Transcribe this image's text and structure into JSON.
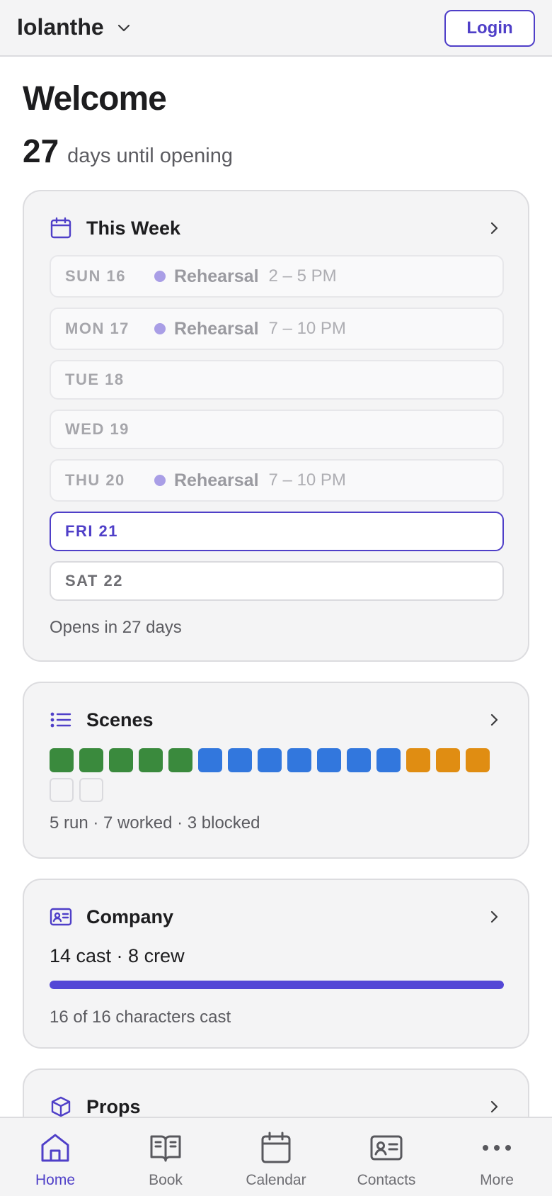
{
  "header": {
    "show_name": "Iolanthe",
    "login_label": "Login"
  },
  "welcome": {
    "title": "Welcome",
    "days_number": "27",
    "days_label": "days until opening"
  },
  "this_week": {
    "title": "This Week",
    "days": [
      {
        "day": "SUN 16",
        "event": "Rehearsal",
        "time": "2 – 5 PM",
        "state": "past"
      },
      {
        "day": "MON 17",
        "event": "Rehearsal",
        "time": "7 – 10 PM",
        "state": "past"
      },
      {
        "day": "TUE 18",
        "event": "",
        "time": "",
        "state": "past"
      },
      {
        "day": "WED 19",
        "event": "",
        "time": "",
        "state": "past"
      },
      {
        "day": "THU 20",
        "event": "Rehearsal",
        "time": "7 – 10 PM",
        "state": "past"
      },
      {
        "day": "FRI 21",
        "event": "",
        "time": "",
        "state": "today"
      },
      {
        "day": "SAT 22",
        "event": "",
        "time": "",
        "state": "future"
      }
    ],
    "footer": "Opens in 27 days"
  },
  "scenes": {
    "title": "Scenes",
    "statuses": [
      "run",
      "run",
      "run",
      "run",
      "run",
      "worked",
      "worked",
      "worked",
      "worked",
      "worked",
      "worked",
      "worked",
      "blocked",
      "blocked",
      "blocked",
      "none",
      "none"
    ],
    "status_colors": {
      "run": "#3a8a3d",
      "worked": "#3277dd",
      "blocked": "#e08d12"
    },
    "summary": "5 run · 7 worked · 3 blocked"
  },
  "company": {
    "title": "Company",
    "counts": "14 cast · 8 crew",
    "cast_progress": 1.0,
    "summary": "16 of 16 characters cast"
  },
  "props": {
    "title": "Props"
  },
  "tabbar": {
    "tabs": [
      {
        "label": "Home",
        "icon": "home-icon",
        "active": true
      },
      {
        "label": "Book",
        "icon": "book-icon",
        "active": false
      },
      {
        "label": "Calendar",
        "icon": "calendar-icon",
        "active": false
      },
      {
        "label": "Contacts",
        "icon": "contact-card-icon",
        "active": false
      },
      {
        "label": "More",
        "icon": "more-dots-icon",
        "active": false
      }
    ]
  },
  "colors": {
    "accent": "#4f3fc8",
    "event_dot": "#a99ee6"
  }
}
